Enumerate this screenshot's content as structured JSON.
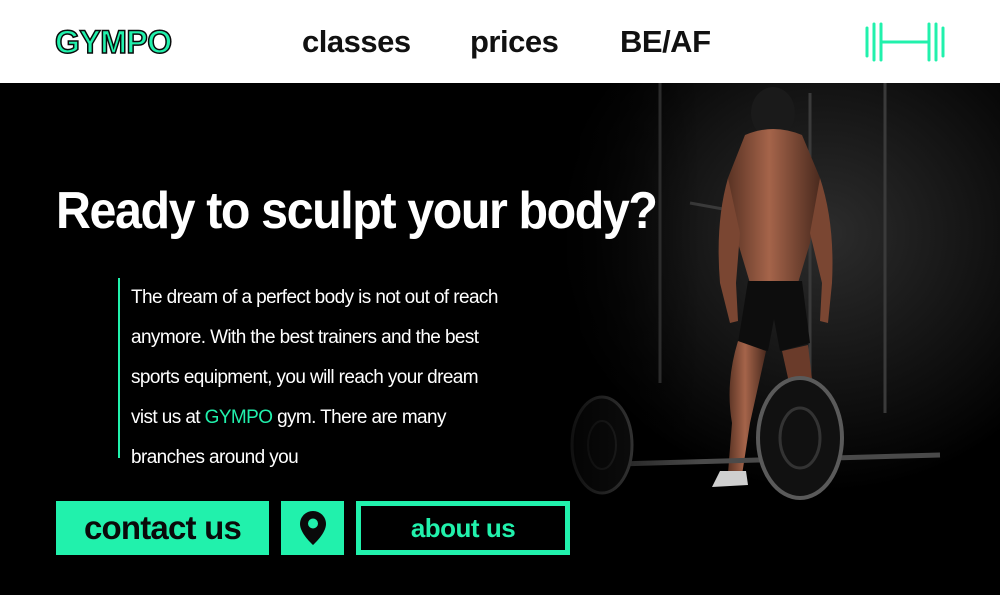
{
  "header": {
    "logo": "GYMPO",
    "nav": [
      "classes",
      "prices",
      "BE/AF"
    ],
    "brand_icon": "dumbbell-icon"
  },
  "hero": {
    "headline": "Ready to sculpt your body?",
    "description": {
      "line1": "The dream of a perfect body is not out of reach",
      "line2": "anymore. With the best trainers and the best",
      "line3": "sports equipment, you will reach your dream",
      "line4_before": "vist us at ",
      "line4_highlight": "GYMPO",
      "line4_after": " gym. There are many",
      "line5": "branches around you"
    },
    "buttons": {
      "contact": "contact us",
      "location_icon": "map-pin-icon",
      "about": "about us"
    },
    "photo": "bodybuilder-with-barbell"
  },
  "colors": {
    "accent": "#21f1ac",
    "dark": "#000000",
    "light": "#ffffff"
  }
}
